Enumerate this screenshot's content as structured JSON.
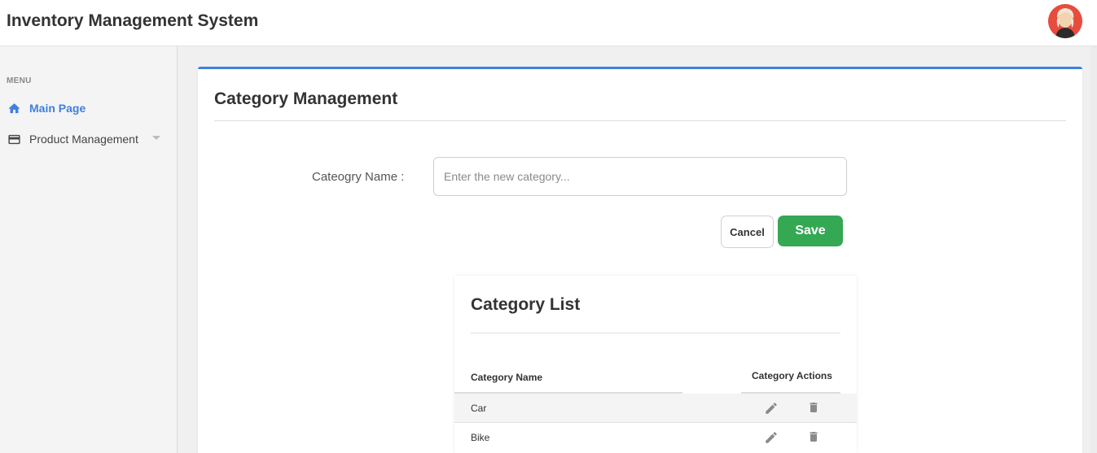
{
  "app": {
    "title": "Inventory Management System"
  },
  "sidebar": {
    "menu_heading": "MENU",
    "items": [
      {
        "label": "Main Page",
        "icon": "home-icon",
        "active": true
      },
      {
        "label": "Product Management",
        "icon": "card-icon",
        "has_dropdown": true
      }
    ]
  },
  "page": {
    "title": "Category Management",
    "form": {
      "category_label": "Cateogry Name :",
      "category_value": "",
      "category_placeholder": "Enter the new category...",
      "cancel_label": "Cancel",
      "save_label": "Save"
    },
    "list": {
      "title": "Category List",
      "columns": [
        "Category Name",
        "Category Actions"
      ],
      "rows": [
        {
          "name": "Car"
        },
        {
          "name": "Bike"
        }
      ]
    }
  },
  "colors": {
    "accent": "#3f7fe0",
    "save": "#34a853",
    "avatar_bg": "#e84c3d"
  }
}
